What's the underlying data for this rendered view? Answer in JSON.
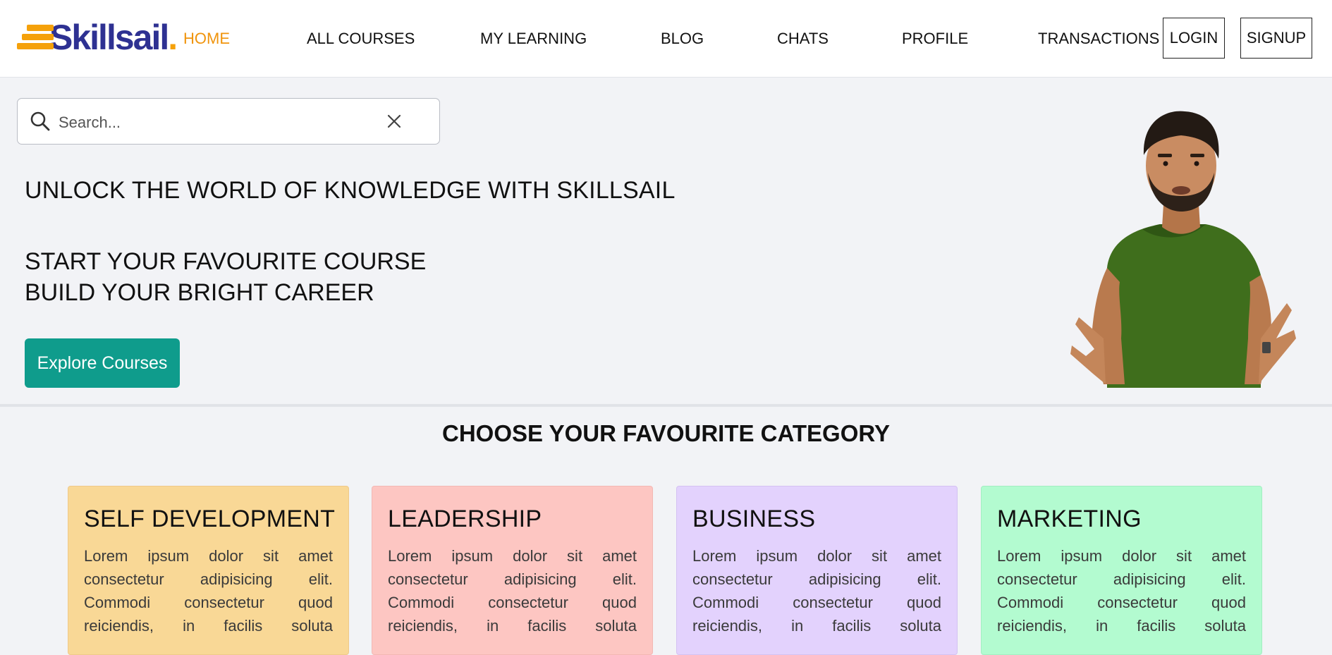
{
  "brand": {
    "name": "Skillsail",
    "dot": ".",
    "accent": "#f5a10a",
    "primary": "#2e3192"
  },
  "nav": {
    "items": [
      "HOME",
      "ALL COURSES",
      "MY LEARNING",
      "BLOG",
      "CHATS",
      "PROFILE",
      "TRANSACTIONS"
    ],
    "active": "HOME",
    "login": "LOGIN",
    "signup": "SIGNUP"
  },
  "search": {
    "placeholder": "Search...",
    "value": ""
  },
  "hero": {
    "title": "UNLOCK THE WORLD OF KNOWLEDGE WITH SKILLSAIL",
    "line1": "START YOUR FAVOURITE COURSE",
    "line2": "BUILD YOUR BRIGHT CAREER",
    "cta": "Explore Courses",
    "cta_color": "#0f9c8c"
  },
  "categories": {
    "title": "CHOOSE YOUR FAVOURITE CATEGORY",
    "cards": [
      {
        "name": "SELF DEVELOPMENT",
        "text": "Lorem ipsum dolor sit amet consectetur adipisicing elit. Commodi consectetur quod reiciendis, in facilis soluta",
        "bg": "#f9d896",
        "border": "#efc98a"
      },
      {
        "name": "LEADERSHIP",
        "text": "Lorem ipsum dolor sit amet consectetur adipisicing elit. Commodi consectetur quod reiciendis, in facilis soluta",
        "bg": "#fdc6c2",
        "border": "#f3b8b4"
      },
      {
        "name": "BUSINESS",
        "text": "Lorem ipsum dolor sit amet consectetur adipisicing elit. Commodi consectetur quod reiciendis, in facilis soluta",
        "bg": "#e3d2fd",
        "border": "#d4c2f2"
      },
      {
        "name": "MARKETING",
        "text": "Lorem ipsum dolor sit amet consectetur adipisicing elit. Commodi consectetur quod reiciendis, in facilis soluta",
        "bg": "#b3fbd0",
        "border": "#a3eec2"
      }
    ]
  }
}
